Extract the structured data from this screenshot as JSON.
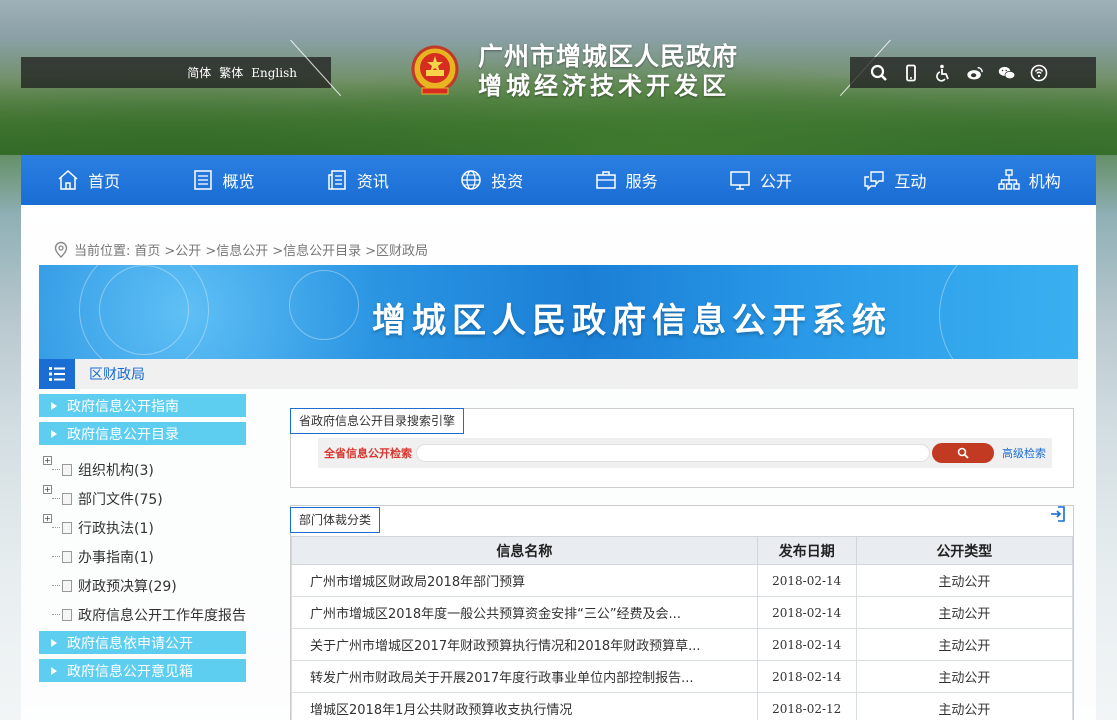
{
  "header": {
    "lang_simplified": "简体",
    "lang_traditional": "繁体",
    "lang_english": "English",
    "title_line1": "广州市增城区人民政府",
    "title_line2": "增城经济技术开发区",
    "tool_icons": [
      "search-icon",
      "mobile-icon",
      "accessibility-icon",
      "weibo-icon",
      "wechat-icon",
      "voice-icon"
    ]
  },
  "nav": {
    "items": [
      {
        "label": "首页",
        "icon": "home-icon"
      },
      {
        "label": "概览",
        "icon": "overview-icon"
      },
      {
        "label": "资讯",
        "icon": "news-icon"
      },
      {
        "label": "投资",
        "icon": "globe-icon"
      },
      {
        "label": "服务",
        "icon": "briefcase-icon"
      },
      {
        "label": "公开",
        "icon": "monitor-icon"
      },
      {
        "label": "互动",
        "icon": "chat-icon"
      },
      {
        "label": "机构",
        "icon": "org-chart-icon"
      }
    ]
  },
  "breadcrumb": {
    "prefix": "当前位置:",
    "items": [
      "首页",
      ">公开",
      ">信息公开",
      ">信息公开目录",
      ">区财政局"
    ]
  },
  "banner": {
    "title": "增城区人民政府信息公开系统"
  },
  "subbar": {
    "label": "区财政局"
  },
  "left_menu": {
    "top": [
      "政府信息公开指南",
      "政府信息公开目录"
    ],
    "tree": [
      {
        "label": "组织机构(3)",
        "expandable": true
      },
      {
        "label": "部门文件(75)",
        "expandable": true
      },
      {
        "label": "行政执法(1)",
        "expandable": true
      },
      {
        "label": "办事指南(1)",
        "expandable": false
      },
      {
        "label": "财政预决算(29)",
        "expandable": false
      },
      {
        "label": "政府信息公开工作年度报告",
        "expandable": false
      }
    ],
    "bottom": [
      "政府信息依申请公开",
      "政府信息公开意见箱"
    ]
  },
  "search": {
    "tab": "省政府信息公开目录搜索引擎",
    "label": "全省信息公开检索",
    "placeholder": "",
    "advanced": "高级检索"
  },
  "list": {
    "tab": "部门体裁分类",
    "columns": [
      "信息名称",
      "发布日期",
      "公开类型"
    ],
    "rows": [
      {
        "name": "广州市增城区财政局2018年部门预算",
        "date": "2018-02-14",
        "type": "主动公开"
      },
      {
        "name": "广州市增城区2018年度一般公共预算资金安排“三公”经费及会...",
        "date": "2018-02-14",
        "type": "主动公开"
      },
      {
        "name": "关于广州市增城区2017年财政预算执行情况和2018年财政预算草...",
        "date": "2018-02-14",
        "type": "主动公开"
      },
      {
        "name": "转发广州市财政局关于开展2017年度行政事业单位内部控制报告...",
        "date": "2018-02-14",
        "type": "主动公开"
      },
      {
        "name": "增城区2018年1月公共财政预算收支执行情况",
        "date": "2018-02-12",
        "type": "主动公开"
      }
    ]
  },
  "colors": {
    "nav_blue": "#1a6dd3",
    "menu_cyan": "#5dcdf0",
    "search_red": "#c23a22"
  }
}
